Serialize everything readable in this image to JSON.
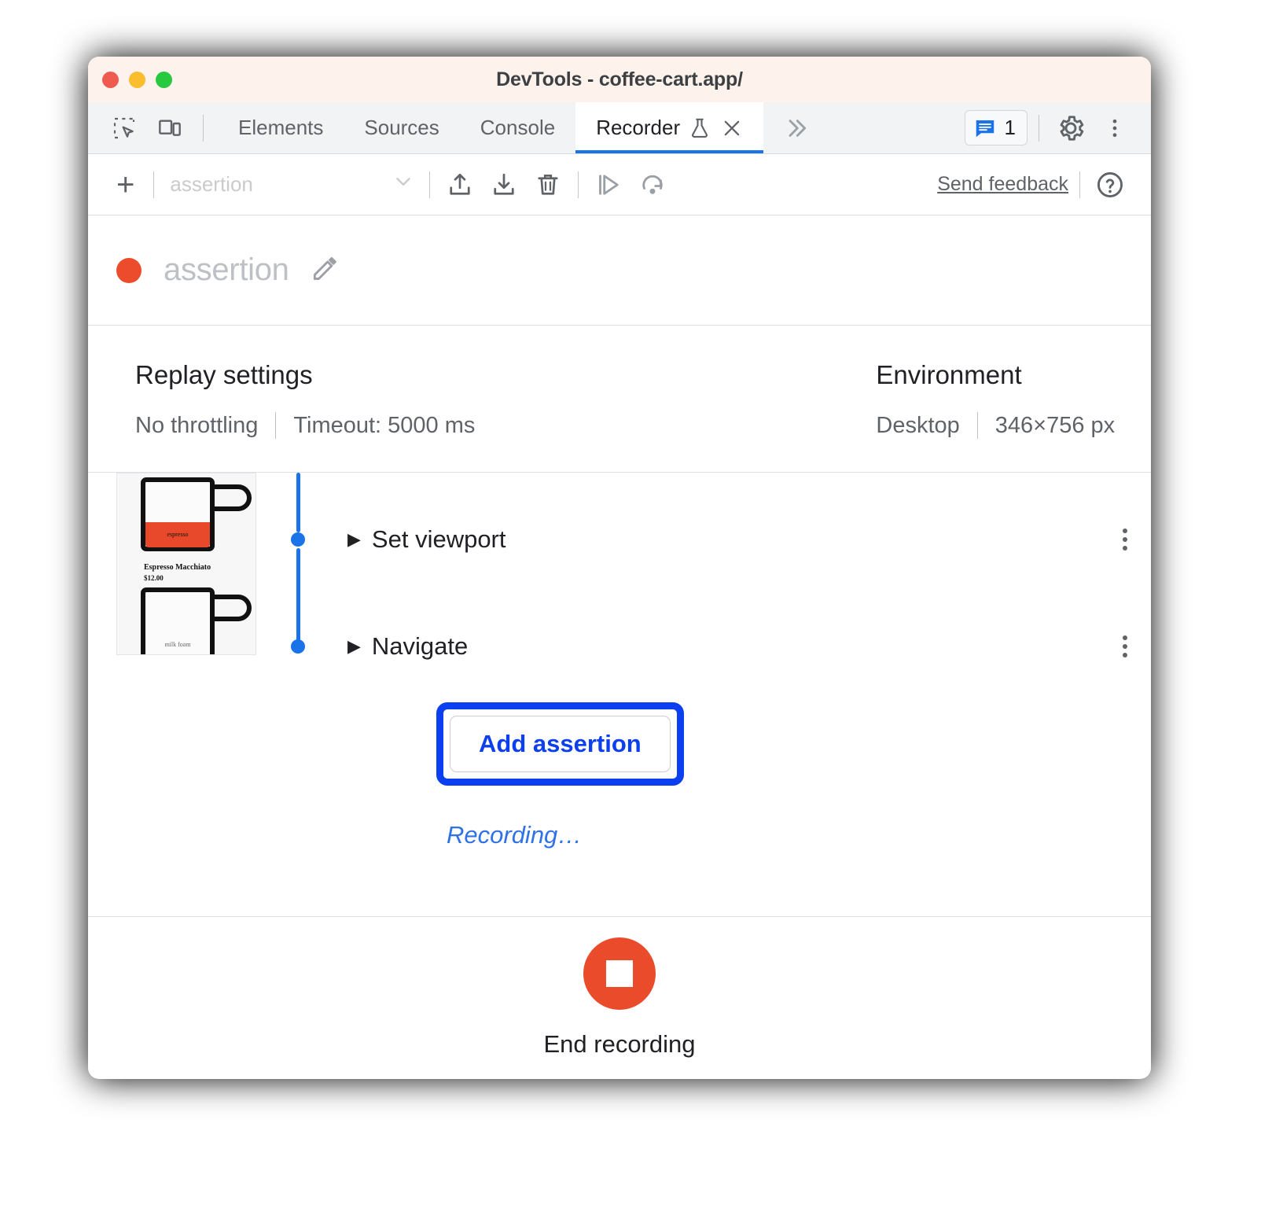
{
  "window": {
    "title": "DevTools - coffee-cart.app/",
    "traffic_lights": [
      "close-red",
      "minimize-yellow",
      "maximize-green"
    ]
  },
  "tabbar": {
    "inspect_icon": "inspect-element-icon",
    "device_icon": "device-toolbar-icon",
    "tabs": [
      {
        "label": "Elements",
        "active": false
      },
      {
        "label": "Sources",
        "active": false
      },
      {
        "label": "Console",
        "active": false
      },
      {
        "label": "Recorder",
        "active": true,
        "experiment_icon": "flask-icon",
        "close_icon": "close-icon"
      }
    ],
    "overflow_icon": "chevron-double-right-icon",
    "messages": {
      "icon": "message-icon",
      "count": "1"
    },
    "settings_icon": "gear-icon",
    "more_icon": "more-vertical-icon"
  },
  "toolbar": {
    "add_icon": "plus-icon",
    "recording_select_value": "assertion",
    "select_chevron": "chevron-down-icon",
    "import_icon": "import-icon",
    "export_icon": "export-icon",
    "delete_icon": "trash-icon",
    "replay_icon": "replay-play-icon",
    "replay_settings_icon": "replay-speed-icon",
    "feedback_label": "Send feedback",
    "help_icon": "help-circle-icon"
  },
  "recording_header": {
    "status_dot": "recording-dot",
    "name": "assertion",
    "edit_icon": "pencil-icon"
  },
  "settings": {
    "replay": {
      "title": "Replay settings",
      "throttling": "No throttling",
      "timeout": "Timeout: 5000 ms"
    },
    "environment": {
      "title": "Environment",
      "device": "Desktop",
      "viewport": "346×756 px"
    }
  },
  "thumbnail": {
    "product_name": "Espresso Macchiato",
    "price": "$12.00",
    "cup_label": "espresso"
  },
  "steps": [
    {
      "caret": "▶",
      "label": "Set viewport",
      "menu_icon": "more-vertical-icon"
    },
    {
      "caret": "▶",
      "label": "Navigate",
      "menu_icon": "more-vertical-icon"
    }
  ],
  "add_assertion": {
    "label": "Add assertion",
    "highlighted": true
  },
  "status": {
    "recording_text": "Recording…"
  },
  "footer": {
    "stop_icon": "stop-square-icon",
    "label": "End recording"
  },
  "colors": {
    "accent_blue": "#1a73e8",
    "highlight_blue": "#0b3ff0",
    "record_red": "#ea4b2b",
    "titlebar_bg": "#fdf2ec",
    "tabbar_bg": "#f1f3f4"
  }
}
